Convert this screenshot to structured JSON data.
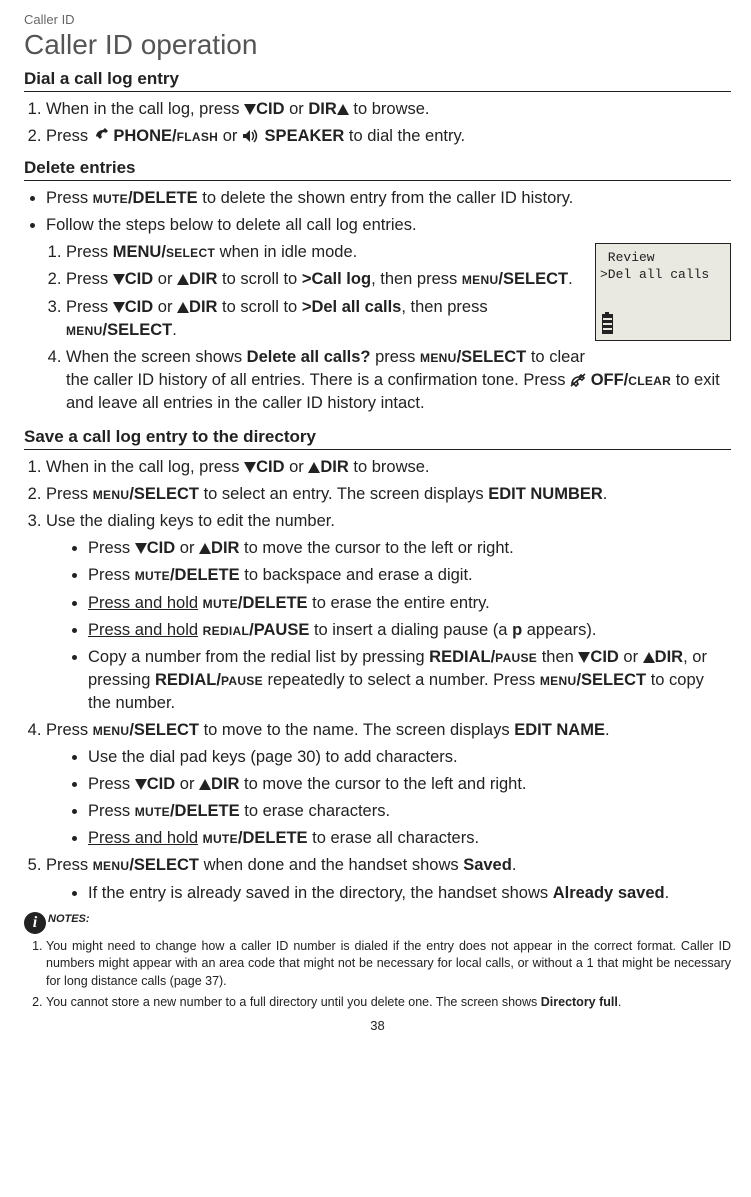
{
  "breadcrumb": "Caller ID",
  "title": "Caller ID operation",
  "sections": {
    "dial": {
      "heading": "Dial a call log entry",
      "step1_a": "When in the call log, press ",
      "step1_cid": "CID",
      "step1_b": " or ",
      "step1_dir": "DIR",
      "step1_c": " to browse.",
      "step2_a": "Press ",
      "step2_phone": " PHONE/",
      "step2_flash": "flash",
      "step2_or": " or ",
      "step2_speaker": " SPEAKER",
      "step2_c": " to dial the entry."
    },
    "delete": {
      "heading": "Delete entries",
      "b1_a": "Press ",
      "b1_mute": "mute",
      "b1_del": "/DELETE",
      "b1_c": " to delete the shown entry from the caller ID history.",
      "b2": "Follow the steps below to delete all call log entries.",
      "s1_a": "Press ",
      "s1_menu": "MENU/",
      "s1_sel": "select",
      "s1_c": " when in idle mode.",
      "s2_a": "Press ",
      "s2_cid": "CID",
      "s2_or": " or ",
      "s2_dir": "DIR",
      "s2_b": " to scroll to ",
      "s2_call": ">Call log",
      "s2_c": ", then press ",
      "s2_menu": "menu",
      "s2_sel": "/SELECT",
      "s2_end": ".",
      "s3_a": "Press ",
      "s3_cid": "CID",
      "s3_or": " or ",
      "s3_dir": "DIR",
      "s3_b": " to scroll to ",
      "s3_del": ">Del all calls",
      "s3_c": ", then press ",
      "s3_menu": "menu",
      "s3_sel": "/SELECT",
      "s3_end": ".",
      "s4_a": "When the screen shows ",
      "s4_q": "Delete all calls?",
      "s4_b": " press ",
      "s4_menu": "menu",
      "s4_sel": "/SELECT",
      "s4_c": " to clear the caller ID history of all entries. There is a confirmation tone. Press ",
      "s4_off": " OFF/",
      "s4_clear": "clear",
      "s4_d": " to exit and leave all entries in the caller ID history intact."
    },
    "save": {
      "heading": "Save a call log entry to the directory",
      "s1_a": "When in the call log, press ",
      "s1_cid": "CID",
      "s1_or": " or ",
      "s1_dir": "DIR",
      "s1_c": " to browse.",
      "s2_a": "Press ",
      "s2_menu": "menu",
      "s2_sel": "/SELECT",
      "s2_b": " to select an entry. The screen displays ",
      "s2_edit": "EDIT NUMBER",
      "s2_end": ".",
      "s3": "Use the dialing keys to edit the number.",
      "s3b1_a": "Press ",
      "s3b1_cid": "CID",
      "s3b1_or": " or ",
      "s3b1_dir": "DIR",
      "s3b1_c": " to move the cursor to the left or right.",
      "s3b2_a": "Press ",
      "s3b2_mute": "mute",
      "s3b2_del": "/DELETE",
      "s3b2_c": " to backspace and erase a digit.",
      "s3b3_a": "Press and hold",
      "s3b3_sp": " ",
      "s3b3_mute": "mute",
      "s3b3_del": "/DELETE",
      "s3b3_c": " to erase the entire entry.",
      "s3b4_a": "Press and hold",
      "s3b4_sp": " ",
      "s3b4_red": "redial",
      "s3b4_pau": "/PAUSE",
      "s3b4_c": " to insert a dialing pause (a ",
      "s3b4_p": "p",
      "s3b4_d": " appears).",
      "s3b5_a": "Copy a number from the redial list by pressing ",
      "s3b5_red": "REDIAL/",
      "s3b5_pau": "pause",
      "s3b5_b": " then ",
      "s3b5_cid": "CID",
      "s3b5_or": " or ",
      "s3b5_dir": "DIR",
      "s3b5_c": ", or pressing ",
      "s3b5_red2": "REDIAL/",
      "s3b5_pau2": "pause",
      "s3b5_d": " repeatedly to select a number. Press ",
      "s3b5_menu": "menu",
      "s3b5_sel": "/SELECT",
      "s3b5_e": " to copy the number.",
      "s4_a": "Press ",
      "s4_menu": "menu",
      "s4_sel": "/SELECT",
      "s4_b": " to move to the name. The screen displays ",
      "s4_edit": "EDIT NAME",
      "s4_end": ".",
      "s4b1": "Use the dial pad keys (page 30) to add characters.",
      "s4b2_a": "Press ",
      "s4b2_cid": "CID",
      "s4b2_or": " or ",
      "s4b2_dir": "DIR",
      "s4b2_c": " to move the cursor to the left and right.",
      "s4b3_a": "Press ",
      "s4b3_mute": "mute",
      "s4b3_del": "/DELETE",
      "s4b3_c": " to erase characters.",
      "s4b4_a": "Press and hold",
      "s4b4_sp": " ",
      "s4b4_mute": "mute",
      "s4b4_del": "/DELETE",
      "s4b4_c": " to erase all characters.",
      "s5_a": "Press ",
      "s5_menu": "menu",
      "s5_sel": "/SELECT",
      "s5_b": " when done and the handset shows ",
      "s5_saved": "Saved",
      "s5_end": ".",
      "s5b1_a": "If the entry is already saved in the directory, the handset shows ",
      "s5b1_as": "Already saved",
      "s5b1_end": "."
    },
    "lcd": {
      "line1": " Review",
      "line2": ">Del all calls"
    },
    "notes": {
      "label": "NOTES:",
      "n1_a": "You might need to change how a caller ID number is dialed if the entry does not appear in the correct format. Caller ID numbers might appear with an area code that might not be necessary for local calls, or without a 1 that might be necessary for long distance calls (page 37).",
      "n2_a": "You cannot store a new number to a full directory until you delete one. The screen shows ",
      "n2_df": "Directory full",
      "n2_end": "."
    },
    "pageno": "38",
    "icons": {
      "info": "i"
    }
  }
}
